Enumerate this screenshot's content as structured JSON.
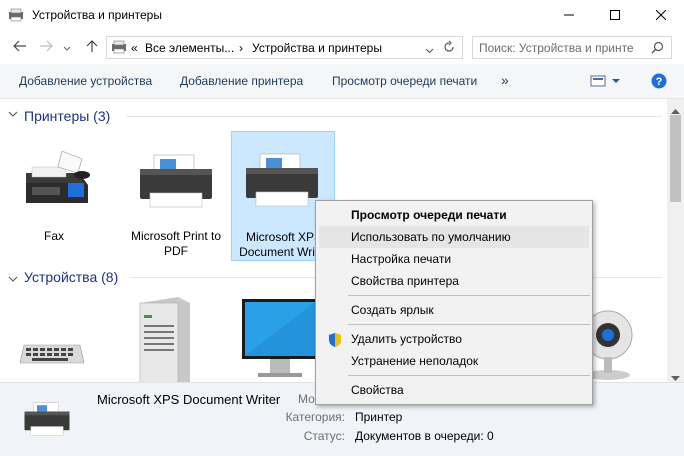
{
  "window": {
    "title": "Устройства и принтеры",
    "minimize_icon": "minimize-icon",
    "maximize_icon": "maximize-icon",
    "close_icon": "close-icon"
  },
  "address": {
    "prefix": "«",
    "crumb1": "Все элементы...",
    "sep": "›",
    "crumb2": "Устройства и принтеры",
    "search_placeholder": "Поиск: Устройства и принте"
  },
  "toolbar": {
    "add_device": "Добавление устройства",
    "add_printer": "Добавление принтера",
    "view_queue": "Просмотр очереди печати",
    "more": "»"
  },
  "groups": {
    "printers_header": "Принтеры (3)",
    "devices_header": "Устройства (8)"
  },
  "printers": [
    {
      "label": "Fax"
    },
    {
      "label": "Microsoft Print to PDF"
    },
    {
      "label": "Microsoft XPS Document Writer"
    }
  ],
  "context_menu": {
    "items": [
      {
        "label": "Просмотр очереди печати",
        "bold": true
      },
      {
        "label": "Использовать по умолчанию",
        "hover": true
      },
      {
        "label": "Настройка печати"
      },
      {
        "label": "Свойства принтера"
      },
      {
        "label": "Создать ярлык"
      },
      {
        "label": "Удалить устройство",
        "icon": "shield-icon"
      },
      {
        "label": "Устранение неполадок"
      },
      {
        "label": "Свойства"
      }
    ]
  },
  "details": {
    "name": "Microsoft XPS Document Writer",
    "name_suffix": "Мо",
    "category_label": "Категория:",
    "category_value": "Принтер",
    "status_label": "Статус:",
    "status_value": "Документов в очереди: 0"
  }
}
